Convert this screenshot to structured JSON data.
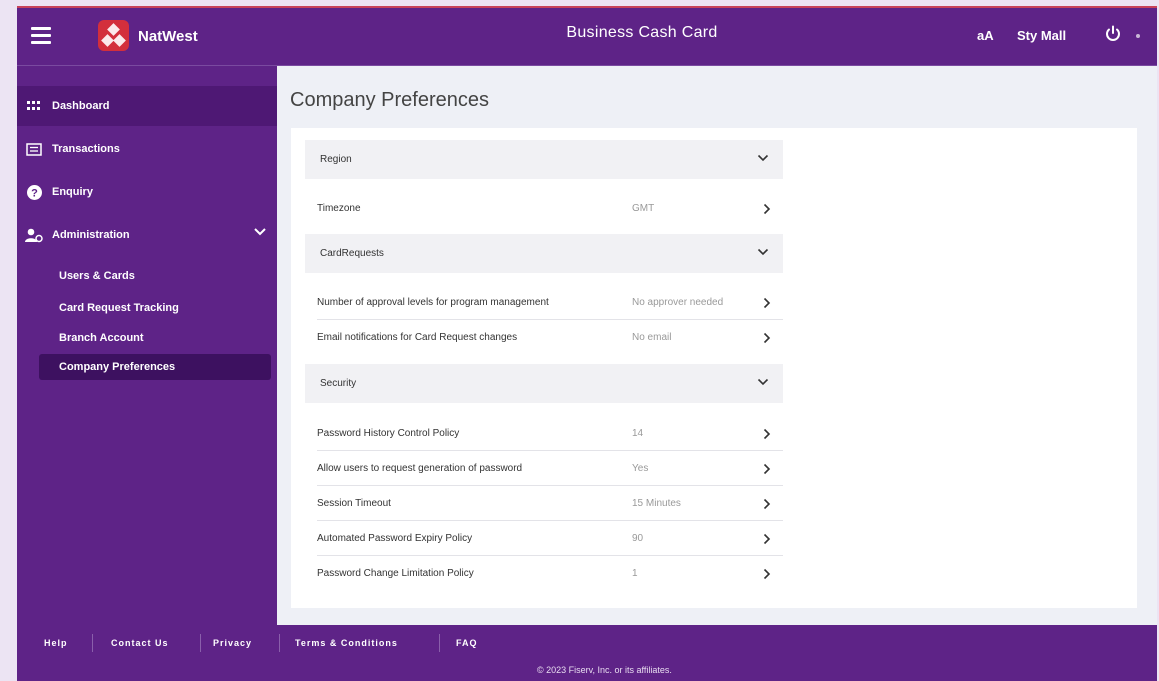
{
  "header": {
    "brand": "NatWest",
    "app_title": "Business Cash Card",
    "text_size_label": "aA",
    "user_name": "Sty Mall"
  },
  "sidebar": {
    "items": [
      {
        "label": "Dashboard",
        "icon": "grid-icon"
      },
      {
        "label": "Transactions",
        "icon": "list-card-icon"
      },
      {
        "label": "Enquiry",
        "icon": "help-circle-icon"
      },
      {
        "label": "Administration",
        "icon": "user-admin-icon"
      }
    ],
    "subitems": [
      {
        "label": "Users & Cards"
      },
      {
        "label": "Card Request Tracking"
      },
      {
        "label": "Branch Account"
      },
      {
        "label": "Company Preferences"
      }
    ]
  },
  "main": {
    "page_title": "Company Preferences",
    "sections": [
      {
        "title": "Region",
        "rows": [
          {
            "label": "Timezone",
            "value": "GMT"
          }
        ]
      },
      {
        "title": "CardRequests",
        "rows": [
          {
            "label": "Number of approval levels for program management",
            "value": "No approver needed"
          },
          {
            "label": "Email notifications for Card Request changes",
            "value": "No email"
          }
        ]
      },
      {
        "title": "Security",
        "rows": [
          {
            "label": "Password History Control Policy",
            "value": "14"
          },
          {
            "label": "Allow users to request generation of password",
            "value": "Yes"
          },
          {
            "label": "Session Timeout",
            "value": "15 Minutes"
          },
          {
            "label": "Automated Password Expiry Policy",
            "value": "90"
          },
          {
            "label": "Password Change Limitation Policy",
            "value": "1"
          }
        ]
      }
    ]
  },
  "footer": {
    "links": [
      "Help",
      "Contact Us",
      "Privacy",
      "Terms & Conditions",
      "FAQ"
    ],
    "copyright": "© 2023 Fiserv, Inc. or its affiliates."
  },
  "colors": {
    "brand_purple": "#5e2387",
    "sidebar_active": "#3d1160",
    "logo_red": "#d32f3c"
  }
}
